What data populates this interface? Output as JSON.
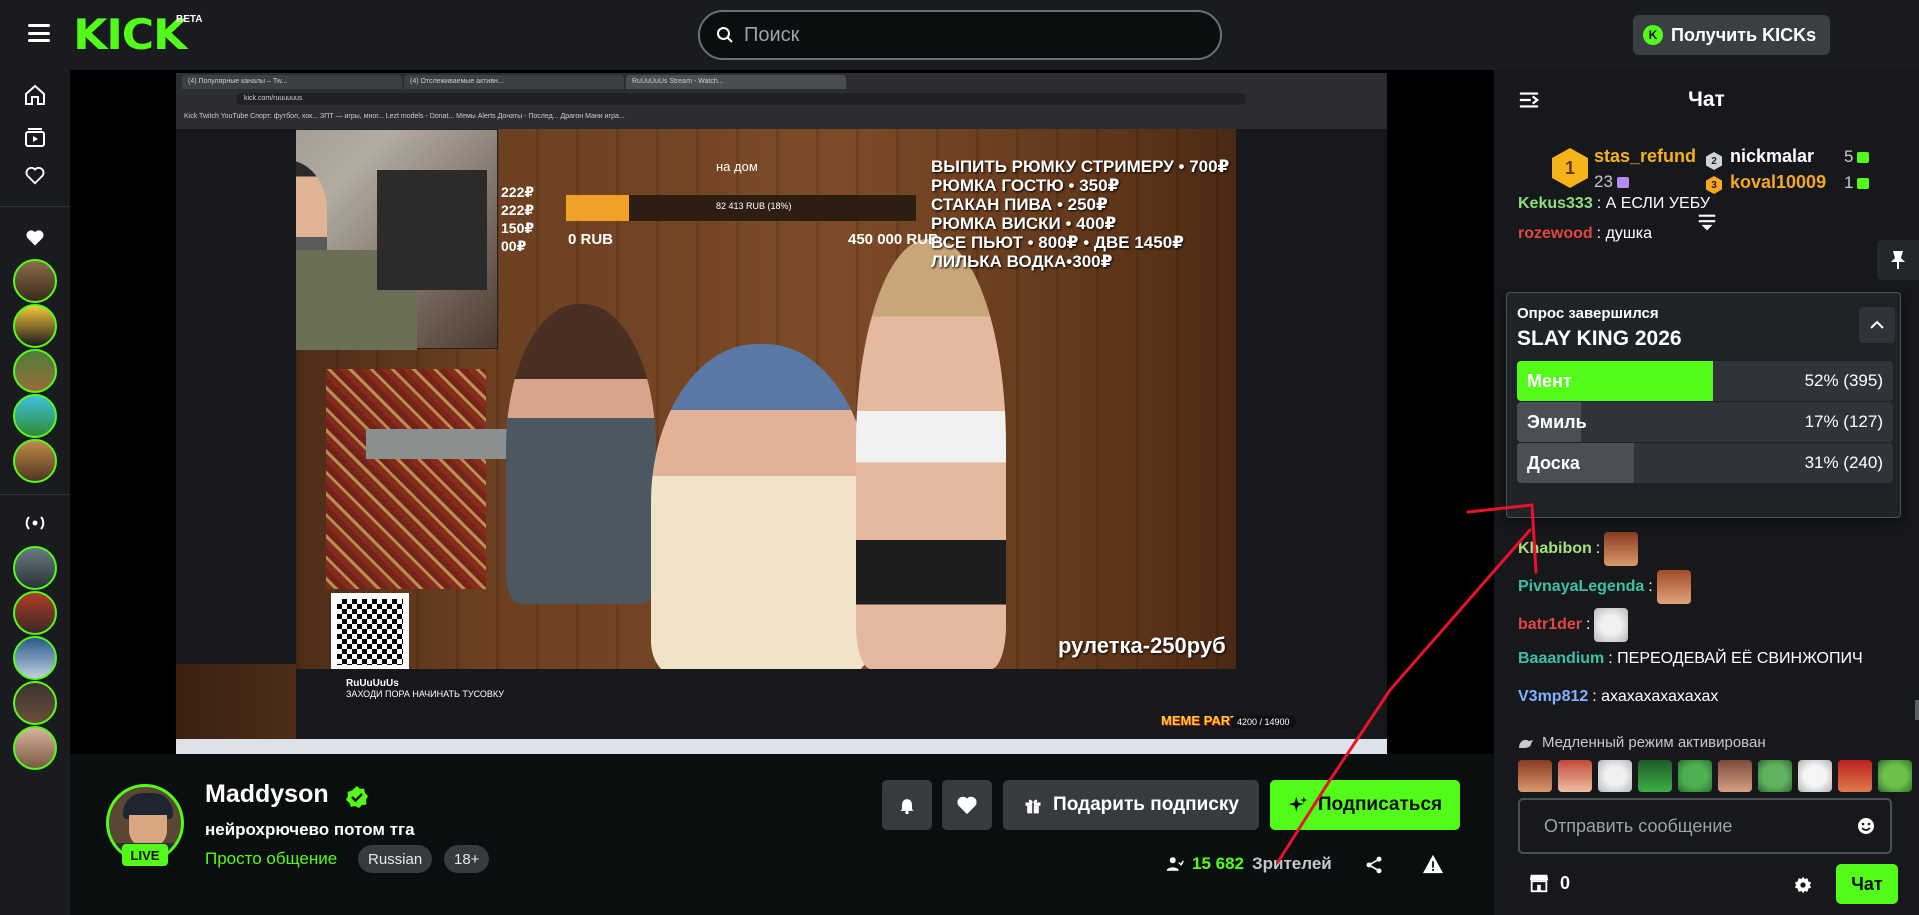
{
  "header": {
    "logo": "KICK",
    "logo_badge": "BETA",
    "search_placeholder": "Поиск",
    "get_kicks_label": "Получить KICKs"
  },
  "video": {
    "browser_tabs": [
      "(4) Популярные каналы – Tw...",
      "(4) Отслеживаемые активн...",
      "RuUuUuUs Stream - Watch..."
    ],
    "browser_url": "kick.com/ruuuuuus",
    "bookmarks": "Kick   Twitch   YouTube   Спорт: футбол, хок...   ЗПТ — игры, мног...   Lezt models - Donat...   Мемы Alerts   Донаты - Послед...   Драгон Мани игра...",
    "donation_menu": [
      "ВЫПИТЬ РЮМКУ СТРИМЕРУ • 700₽",
      "РЮМКА ГОСТЮ • 350₽",
      "СТАКАН ПИВА • 250₽",
      "РЮМКА ВИСКИ • 400₽",
      "ВСЕ ПЬЮТ • 800₽ • ДВЕ 1450₽",
      "ЛИЛЬКА ВОДКА•300₽"
    ],
    "side_prices": [
      "222₽",
      "222₽",
      "150₽",
      "00₽"
    ],
    "goal_label": "на дом",
    "goal_progress_text": "82 413 RUB (18%)",
    "goal_fraction": 0.18,
    "goal_min": "0 RUB",
    "goal_max": "450 000 RUB",
    "roulette": "рулетка-250руб",
    "inner_streamer": "RuUuUuUs",
    "inner_title": "ЗАХОДИ ПОРА НАЧИНАТЬ ТУСОВКУ",
    "meme_party": "MEME PARTY",
    "meme_counter": "4200 / 14900"
  },
  "channel": {
    "name": "Maddyson",
    "live_badge": "LIVE",
    "stream_title": "нейрохрючево потом тга",
    "category": "Просто общение",
    "tags": [
      "Russian",
      "18+"
    ],
    "gift_sub_label": "Подарить подписку",
    "subscribe_label": "Подписаться",
    "viewers_count": "15 682",
    "viewers_label": "Зрителей"
  },
  "chat": {
    "title": "Чат",
    "leaderboard": [
      {
        "rank": "1",
        "name": "stas_refund",
        "count": "23",
        "color": "#f5b21b"
      },
      {
        "rank": "2",
        "name": "nickmalar",
        "count": "5",
        "color": "#ffffff"
      },
      {
        "rank": "3",
        "name": "koval10009",
        "count": "1",
        "color": "#f5a623"
      }
    ],
    "messages_top": [
      {
        "user": "Kekus333",
        "text": ": А ЕСЛИ УЕБУ",
        "color": "#8ee07a"
      },
      {
        "user": "rozewood",
        "text": ": душка",
        "color": "#e64545"
      }
    ],
    "poll": {
      "status": "Опрос завершился",
      "question": "SLAY KING 2026",
      "options": [
        {
          "label": "Мент",
          "percent_text": "52% (395)",
          "fraction": 0.52,
          "winner": true
        },
        {
          "label": "Эмиль",
          "percent_text": "17% (127)",
          "fraction": 0.17,
          "winner": false
        },
        {
          "label": "Доска",
          "percent_text": "31% (240)",
          "fraction": 0.31,
          "winner": false
        }
      ]
    },
    "messages_bottom": [
      {
        "user": "Khabibon",
        "text": ":",
        "color": "#a5e27d",
        "emote": true
      },
      {
        "user": "PivnayaLegenda",
        "text": ":",
        "color": "#3dc0a8",
        "emote": true
      },
      {
        "user": "batr1der",
        "text": ":",
        "color": "#e64545",
        "emote": true
      },
      {
        "user": "Baaandium",
        "text": ": ПЕРЕОДЕВАЙ ЕЁ СВИНЖОПИЧ",
        "color": "#3dc0a8",
        "emote": false
      },
      {
        "user": "V3mp812",
        "text": ": ахахахахахахах",
        "color": "#7fb2ff",
        "emote": false
      }
    ],
    "slow_mode": "Медленный режим активирован",
    "input_placeholder": "Отправить сообщение",
    "store_count": "0",
    "send_label": "Чат"
  },
  "colors": {
    "brand": "#53fc18",
    "background": "#0b0e0f",
    "panel": "#191b1f",
    "annotation": "#e8132a"
  }
}
